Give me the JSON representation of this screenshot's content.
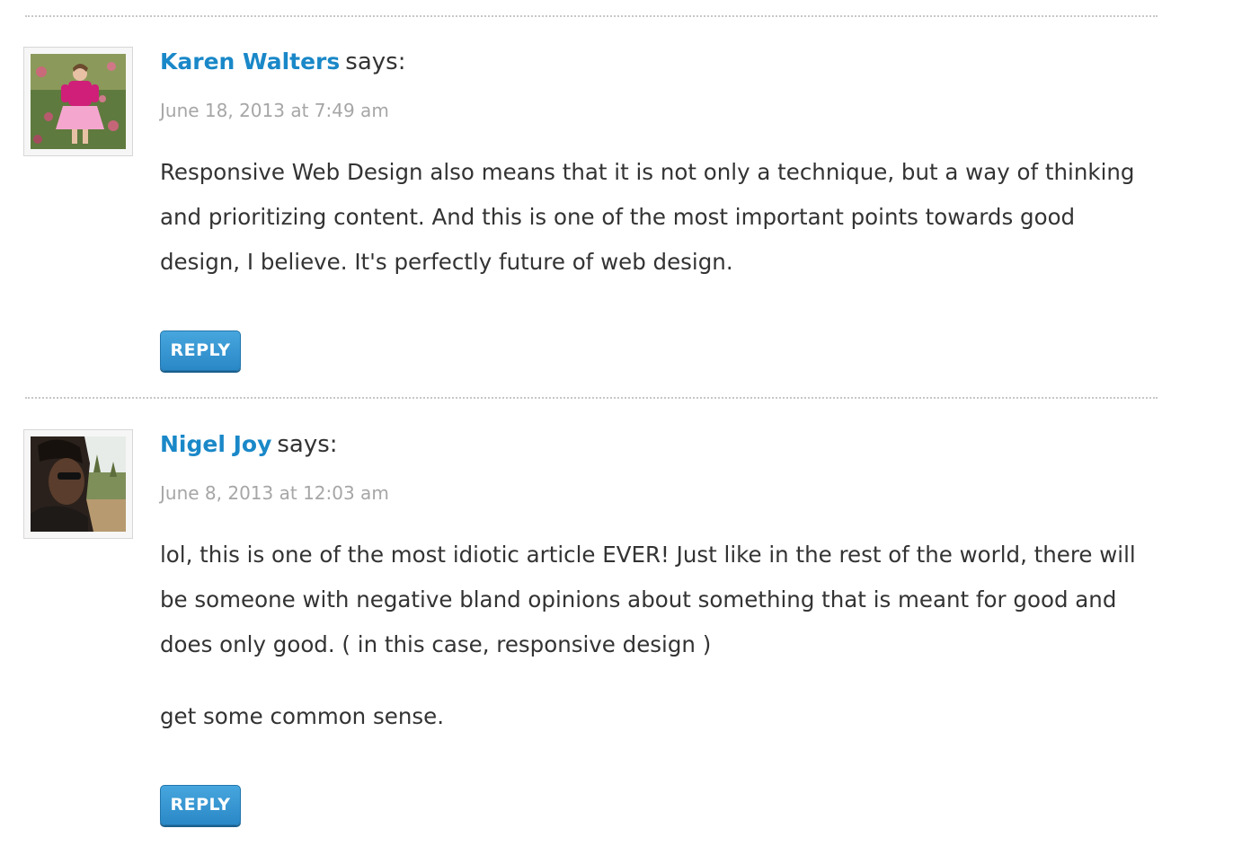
{
  "comments": [
    {
      "author": "Karen Walters",
      "says": "says:",
      "date": "June 18, 2013 at 7:49 am",
      "paragraphs": [
        "Responsive Web Design also means that it is not only a technique, but a way of thinking",
        "and prioritizing content. And this is one of the most important points towards good",
        "design, I believe. It's perfectly future of web design."
      ],
      "reply_label": "REPLY"
    },
    {
      "author": "Nigel Joy",
      "says": "says:",
      "date": "June 8, 2013 at 12:03 am",
      "paragraphs": [
        "lol, this is one of the most idiotic article EVER! Just like in the rest of the world, there will",
        "be someone with negative bland opinions about something that is meant for good and",
        "does only good. ( in this case, responsive design )"
      ],
      "extra_paragraph": "get some common sense.",
      "reply_label": "REPLY"
    }
  ],
  "colors": {
    "author_link": "#1a88c8",
    "date": "#a6a6a6",
    "body_text": "#333333",
    "reply_button": "#2a88c7",
    "divider": "#c7c7c7"
  }
}
